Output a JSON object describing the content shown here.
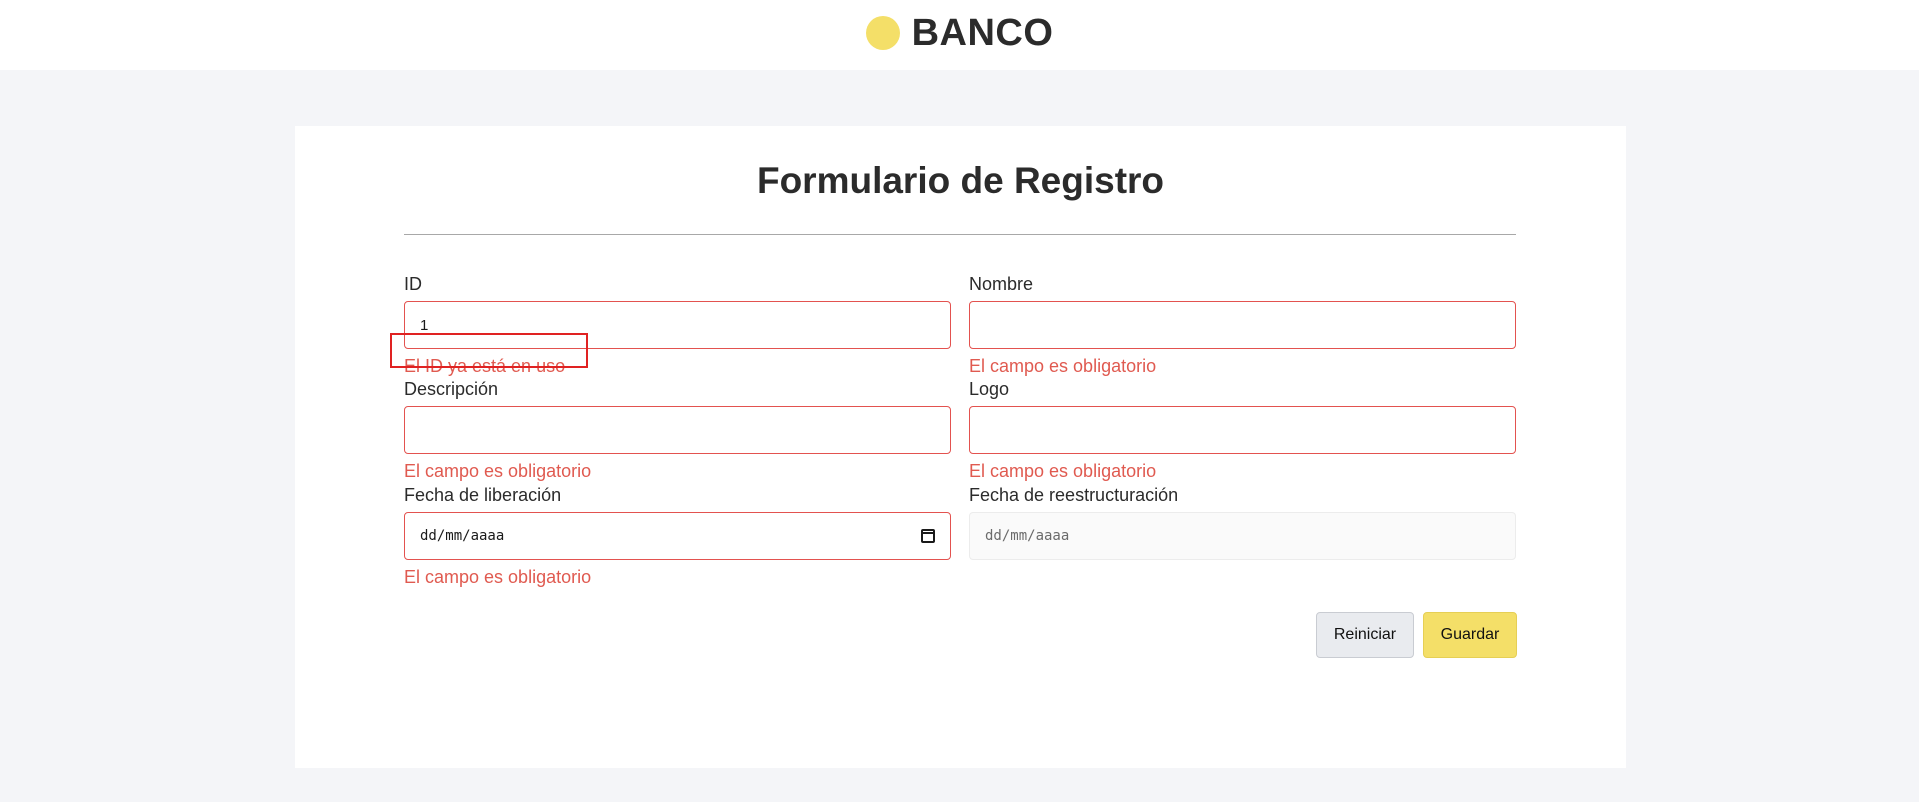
{
  "header": {
    "brand_name": "BANCO",
    "brand_color": "#f4df68"
  },
  "form": {
    "title": "Formulario de Registro",
    "fields": {
      "id": {
        "label": "ID",
        "value": "1",
        "error": "El ID ya está en uso"
      },
      "nombre": {
        "label": "Nombre",
        "value": "",
        "error": "El campo es obligatorio"
      },
      "descripcion": {
        "label": "Descripción",
        "value": "",
        "error": "El campo es obligatorio"
      },
      "logo": {
        "label": "Logo",
        "value": "",
        "error": "El campo es obligatorio"
      },
      "fecha_liberacion": {
        "label": "Fecha de liberación",
        "value": "dd/mm/aaaa",
        "error": "El campo es obligatorio",
        "icon": "calendar-icon"
      },
      "fecha_reestructuracion": {
        "label": "Fecha de reestructuración",
        "value": "dd/mm/aaaa"
      }
    },
    "buttons": {
      "reset_label": "Reiniciar",
      "save_label": "Guardar"
    },
    "colors": {
      "error": "#e05a50",
      "error_border": "#e3524f",
      "highlight": "#e02222",
      "primary_button": "#f4df68",
      "secondary_button": "#e9ebef"
    }
  }
}
